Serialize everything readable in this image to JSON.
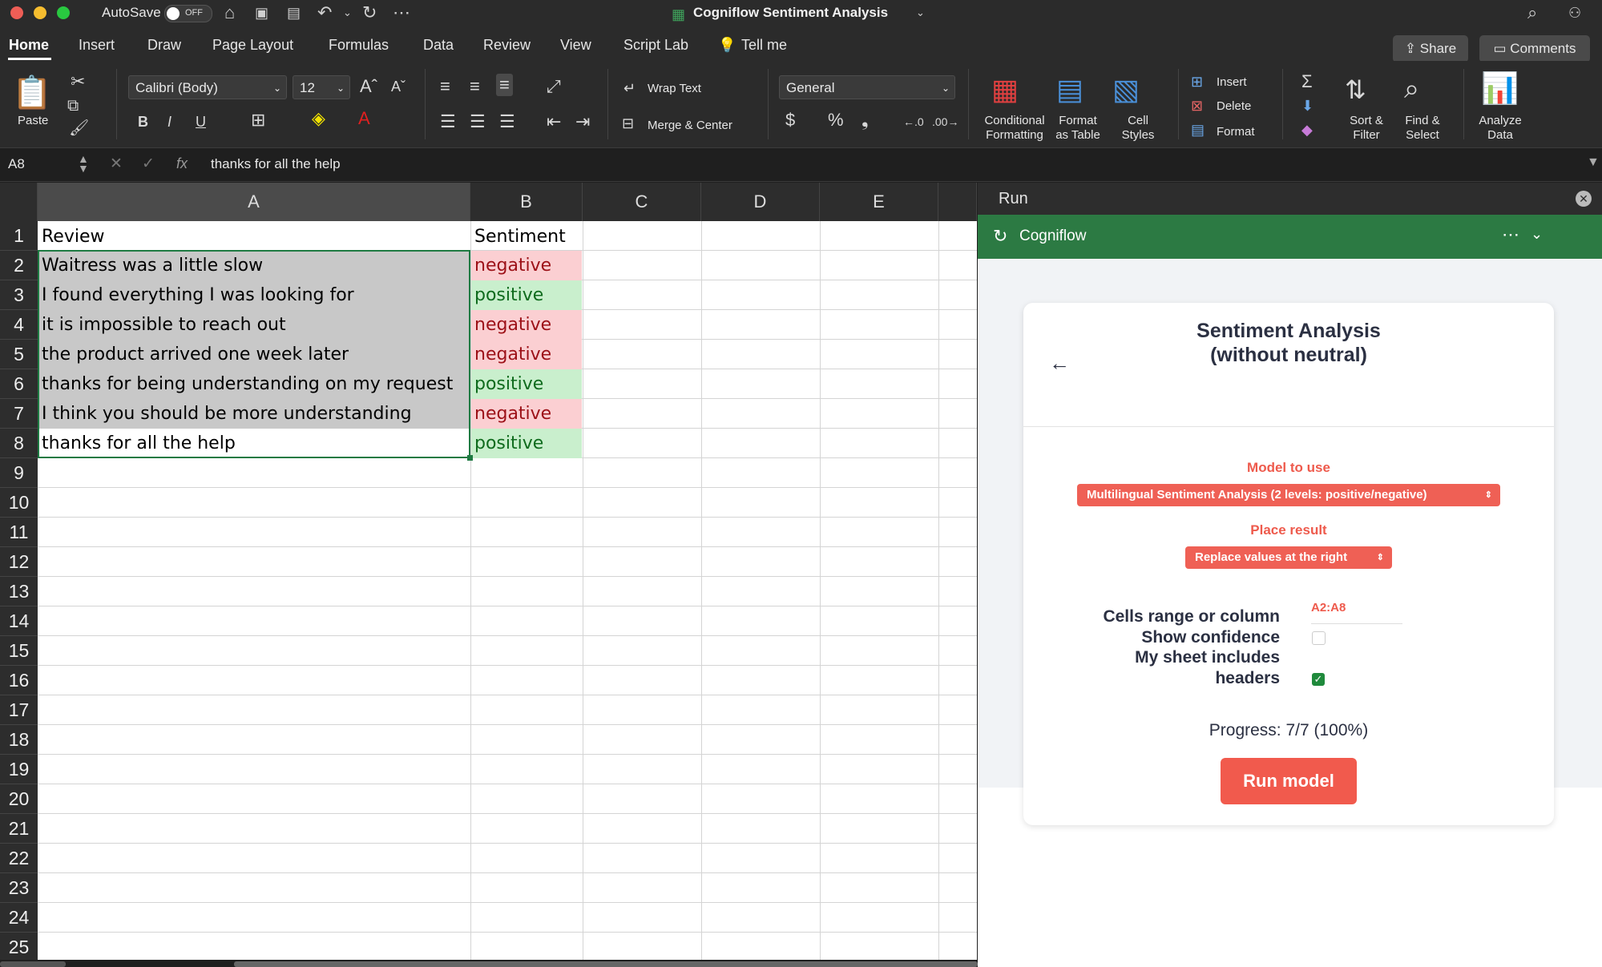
{
  "titlebar": {
    "autosave_label": "AutoSave",
    "autosave_state": "OFF",
    "document_title": "Cogniflow Sentiment Analysis"
  },
  "tabs": [
    "Home",
    "Insert",
    "Draw",
    "Page Layout",
    "Formulas",
    "Data",
    "Review",
    "View",
    "Script Lab"
  ],
  "tell_me": "Tell me",
  "share_label": "Share",
  "comments_label": "Comments",
  "ribbon": {
    "paste": "Paste",
    "font_name": "Calibri (Body)",
    "font_size": "12",
    "bold": "B",
    "italic": "I",
    "underline": "U",
    "wrap_text": "Wrap Text",
    "merge_center": "Merge & Center",
    "number_format": "General",
    "conditional_formatting_1": "Conditional",
    "conditional_formatting_2": "Formatting",
    "format_table_1": "Format",
    "format_table_2": "as Table",
    "cell_styles_1": "Cell",
    "cell_styles_2": "Styles",
    "insert": "Insert",
    "delete": "Delete",
    "format": "Format",
    "sort_filter_1": "Sort &",
    "sort_filter_2": "Filter",
    "find_select_1": "Find &",
    "find_select_2": "Select",
    "analyze_1": "Analyze",
    "analyze_2": "Data"
  },
  "formula_bar": {
    "name_box": "A8",
    "fx": "fx",
    "content": "thanks for all the help"
  },
  "sheet": {
    "columns": [
      "A",
      "B",
      "C",
      "D",
      "E"
    ],
    "row_numbers": [
      "1",
      "2",
      "3",
      "4",
      "5",
      "6",
      "7",
      "8",
      "9",
      "10",
      "11",
      "12",
      "13",
      "14",
      "15",
      "16",
      "17",
      "18",
      "19",
      "20",
      "21",
      "22",
      "23",
      "24",
      "25"
    ],
    "header": {
      "a": "Review",
      "b": "Sentiment"
    },
    "rows": [
      {
        "review": "Waitress was a little slow",
        "sentiment": "negative"
      },
      {
        "review": "I found everything I was looking for",
        "sentiment": "positive"
      },
      {
        "review": "it is impossible to reach out",
        "sentiment": "negative"
      },
      {
        "review": "the product arrived one week later",
        "sentiment": "negative"
      },
      {
        "review": "thanks for being understanding on my request",
        "sentiment": "positive"
      },
      {
        "review": "I think you should be more understanding",
        "sentiment": "negative"
      },
      {
        "review": "thanks for all the help",
        "sentiment": "positive"
      }
    ],
    "colors": {
      "negative_bg": "#fbcfd2",
      "negative_text": "#9c1017",
      "positive_bg": "#c9efcd",
      "positive_text": "#0f6b1d",
      "selection_bg": "#c8c8c8",
      "selection_border": "#1e7a42"
    }
  },
  "pane": {
    "title": "Run",
    "addin_name": "Cogniflow",
    "card_title": "Sentiment Analysis (without neutral)",
    "model_label": "Model to use",
    "model_value": "Multilingual Sentiment Analysis (2 levels: positive/negative)",
    "place_label": "Place result",
    "place_value": "Replace values at the right",
    "range_label": "Cells range or column",
    "range_value": "A2:A8",
    "show_conf_label": "Show confidence",
    "show_conf_checked": false,
    "headers_label_1": "My sheet includes",
    "headers_label_2": "headers",
    "headers_checked": true,
    "progress": "Progress: 7/7 (100%)",
    "run_button": "Run model",
    "accent": "#ef6055",
    "green": "#2c7a43"
  }
}
